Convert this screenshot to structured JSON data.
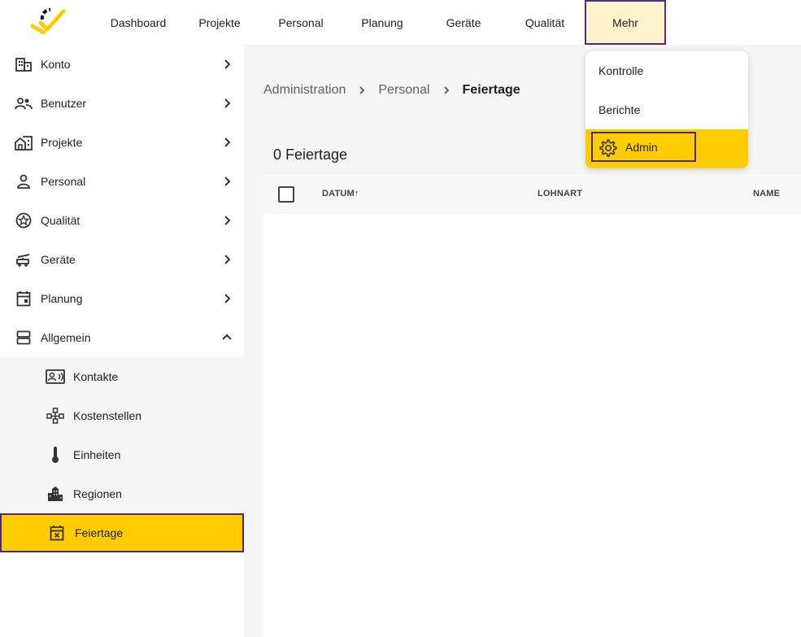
{
  "colors": {
    "accent": "#ffcc00",
    "accent_light": "#fff3cd",
    "focus_border": "#4a2a7a",
    "text": "#212121",
    "muted": "#616161"
  },
  "topnav": {
    "items": [
      {
        "label": "Dashboard"
      },
      {
        "label": "Projekte"
      },
      {
        "label": "Personal"
      },
      {
        "label": "Planung"
      },
      {
        "label": "Geräte"
      },
      {
        "label": "Qualität"
      },
      {
        "label": "Mehr",
        "active": true
      }
    ]
  },
  "dropdown": {
    "items": [
      {
        "label": "Kontrolle",
        "icon": ""
      },
      {
        "label": "Berichte",
        "icon": ""
      },
      {
        "label": "Admin",
        "icon": "gear-icon",
        "highlight": true
      }
    ]
  },
  "sidebar": {
    "items": [
      {
        "label": "Konto",
        "icon": "building-icon"
      },
      {
        "label": "Benutzer",
        "icon": "users-icon"
      },
      {
        "label": "Projekte",
        "icon": "house-building-icon"
      },
      {
        "label": "Personal",
        "icon": "person-icon"
      },
      {
        "label": "Qualität",
        "icon": "star-badge-icon"
      },
      {
        "label": "Geräte",
        "icon": "equipment-icon"
      },
      {
        "label": "Planung",
        "icon": "calendar-icon"
      },
      {
        "label": "Allgemein",
        "icon": "storage-icon",
        "expanded": true
      }
    ],
    "sub_items": [
      {
        "label": "Kontakte",
        "icon": "contact-card-icon"
      },
      {
        "label": "Kostenstellen",
        "icon": "network-icon"
      },
      {
        "label": "Einheiten",
        "icon": "thermometer-icon"
      },
      {
        "label": "Regionen",
        "icon": "city-icon"
      },
      {
        "label": "Feiertage",
        "icon": "calendar-x-icon",
        "active": true
      }
    ]
  },
  "breadcrumb": [
    "Administration",
    "Personal",
    "Feiertage"
  ],
  "main": {
    "count_title": "0 Feiertage",
    "columns": [
      "DATUM",
      "LOHNART",
      "NAME"
    ],
    "sort_indicator": "↑"
  }
}
